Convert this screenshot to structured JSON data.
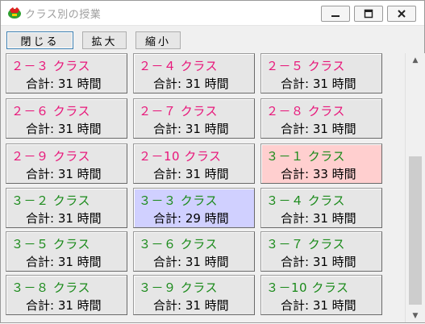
{
  "window": {
    "title": "クラス別の授業",
    "controls": {
      "minimize": "minimize",
      "maximize": "maximize",
      "close": "close"
    }
  },
  "toolbar": {
    "close_label": "閉じる",
    "zoom_in_label": "拡大",
    "zoom_out_label": "縮小"
  },
  "colors": {
    "grade2_text": "#e8167a",
    "grade3_text": "#1a8a1a",
    "cell_default": "#e6e6e6",
    "cell_selected_red": "#ffcfcf",
    "cell_selected_blue": "#d0d0ff"
  },
  "classes": [
    {
      "name": "２－３ クラス",
      "total": "合計: 31 時間",
      "tone": "pink",
      "highlight": ""
    },
    {
      "name": "２－４ クラス",
      "total": "合計: 31 時間",
      "tone": "pink",
      "highlight": ""
    },
    {
      "name": "２－５ クラス",
      "total": "合計: 31 時間",
      "tone": "pink",
      "highlight": ""
    },
    {
      "name": "２－６ クラス",
      "total": "合計: 31 時間",
      "tone": "pink",
      "highlight": ""
    },
    {
      "name": "２－７ クラス",
      "total": "合計: 31 時間",
      "tone": "pink",
      "highlight": ""
    },
    {
      "name": "２－８ クラス",
      "total": "合計: 31 時間",
      "tone": "pink",
      "highlight": ""
    },
    {
      "name": "２－９ クラス",
      "total": "合計: 31 時間",
      "tone": "pink",
      "highlight": ""
    },
    {
      "name": "２－10 クラス",
      "total": "合計: 31 時間",
      "tone": "pink",
      "highlight": ""
    },
    {
      "name": "３－１ クラス",
      "total": "合計: 33 時間",
      "tone": "green",
      "highlight": "red"
    },
    {
      "name": "３－２ クラス",
      "total": "合計: 31 時間",
      "tone": "green",
      "highlight": ""
    },
    {
      "name": "３－３ クラス",
      "total": "合計: 29 時間",
      "tone": "green",
      "highlight": "blue"
    },
    {
      "name": "３－４ クラス",
      "total": "合計: 31 時間",
      "tone": "green",
      "highlight": ""
    },
    {
      "name": "３－５ クラス",
      "total": "合計: 31 時間",
      "tone": "green",
      "highlight": ""
    },
    {
      "name": "３－６ クラス",
      "total": "合計: 31 時間",
      "tone": "green",
      "highlight": ""
    },
    {
      "name": "３－７ クラス",
      "total": "合計: 31 時間",
      "tone": "green",
      "highlight": ""
    },
    {
      "name": "３－８ クラス",
      "total": "合計: 31 時間",
      "tone": "green",
      "highlight": ""
    },
    {
      "name": "３－９ クラス",
      "total": "合計: 31 時間",
      "tone": "green",
      "highlight": ""
    },
    {
      "name": "３－10 クラス",
      "total": "合計: 31 時間",
      "tone": "green",
      "highlight": ""
    }
  ],
  "scrollbar": {
    "up_arrow": "▲",
    "down_arrow": "▼"
  }
}
